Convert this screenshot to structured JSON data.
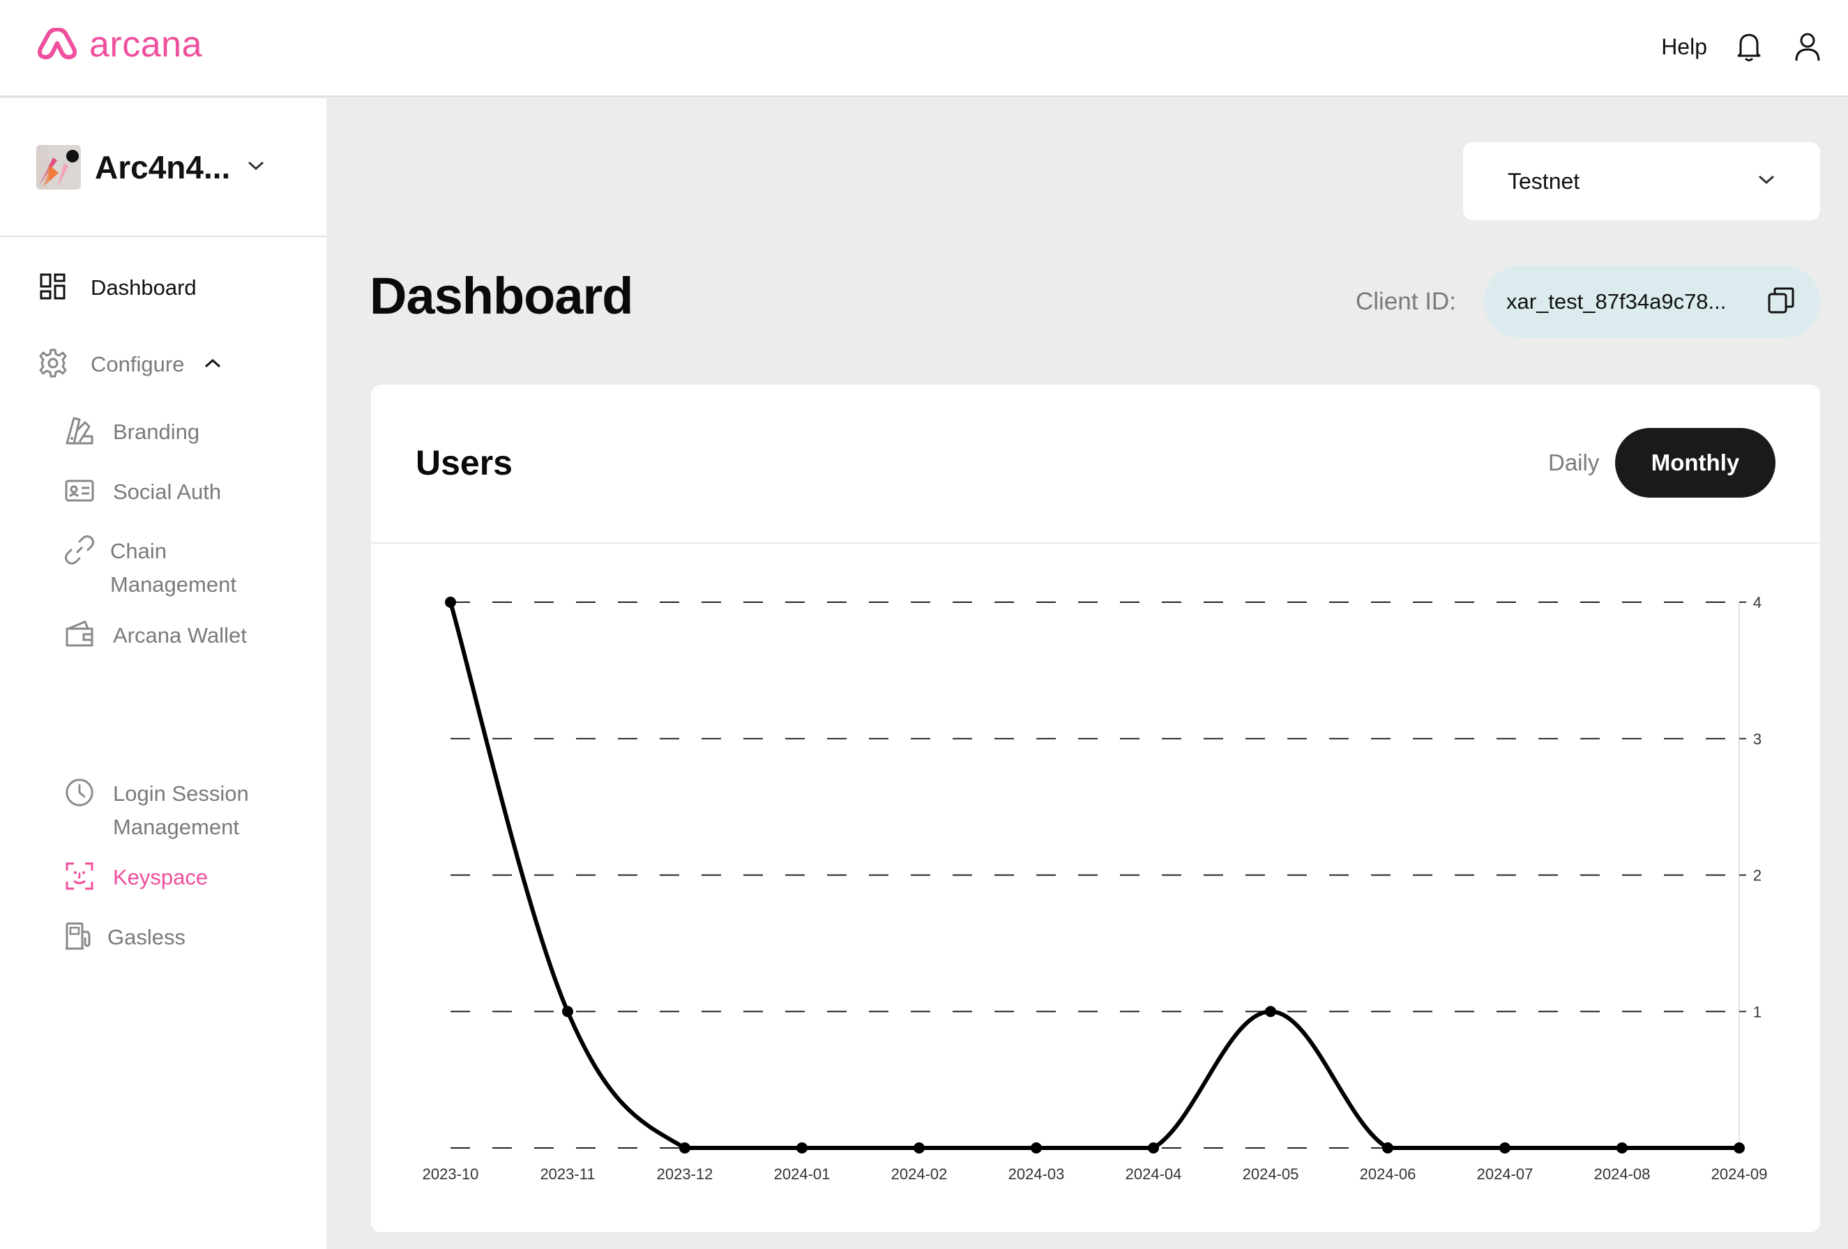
{
  "brand": {
    "name": "arcana",
    "accent": "#ef4f9c"
  },
  "header": {
    "help_label": "Help",
    "icons": [
      "bell-icon",
      "user-icon"
    ]
  },
  "sidebar": {
    "app_name": "Arc4n4...",
    "items": [
      {
        "label": "Dashboard",
        "icon": "grid-icon"
      },
      {
        "label": "Configure",
        "icon": "gear-icon"
      },
      {
        "label": "Branding",
        "icon": "swatch-icon"
      },
      {
        "label": "Social Auth",
        "icon": "id-card-icon"
      },
      {
        "label": "Chain",
        "label2": "Management",
        "icon": "link-icon"
      },
      {
        "label": "Arcana Wallet",
        "icon": "wallet-icon"
      },
      {
        "label": "Login Session",
        "label2": "Management",
        "icon": "clock-icon"
      },
      {
        "label": "Keyspace",
        "icon": "face-scan-icon",
        "active": true
      },
      {
        "label": "Gasless",
        "icon": "fuel-pump-icon"
      }
    ]
  },
  "network": {
    "selected": "Testnet"
  },
  "page": {
    "title": "Dashboard"
  },
  "client": {
    "label": "Client ID:",
    "value": "xar_test_87f34a9c78..."
  },
  "card": {
    "title": "Users",
    "toggle_daily": "Daily",
    "toggle_monthly": "Monthly",
    "selected": "Monthly"
  },
  "chart_data": {
    "type": "line",
    "title": "Users",
    "categories": [
      "2023-10",
      "2023-11",
      "2023-12",
      "2024-01",
      "2024-02",
      "2024-03",
      "2024-04",
      "2024-05",
      "2024-06",
      "2024-07",
      "2024-08",
      "2024-09"
    ],
    "values": [
      4,
      1,
      0,
      0,
      0,
      0,
      0,
      1,
      0,
      0,
      0,
      0
    ],
    "ylim": [
      0,
      4
    ],
    "yticks": [
      1,
      2,
      3,
      4
    ],
    "grid": true,
    "y_axis_side": "right",
    "line_color": "#000000"
  }
}
